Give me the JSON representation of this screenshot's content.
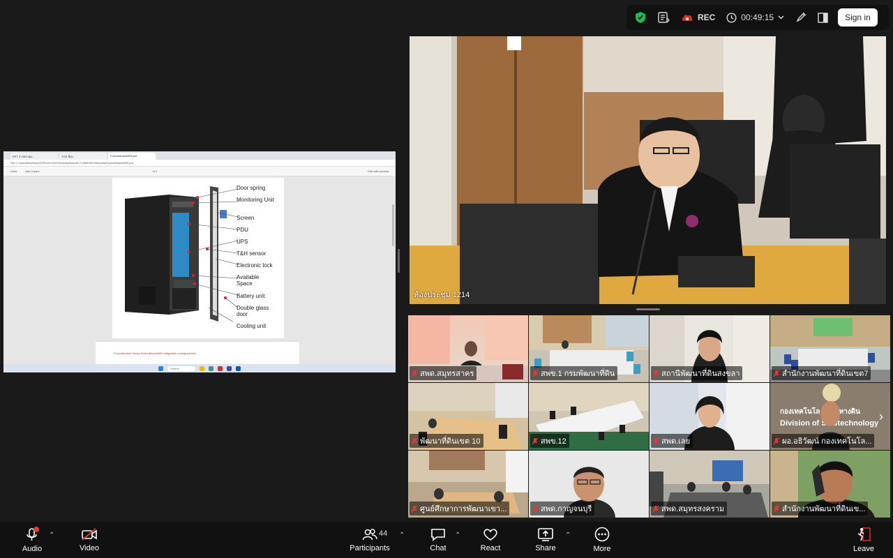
{
  "topbar": {
    "rec_label": "REC",
    "timer": "00:49:15",
    "signin_label": "Sign in"
  },
  "shared_screen": {
    "tabs": [
      "PPT การประชุม...",
      "TOR ห้อง...",
      "FusionModule500.pdf"
    ],
    "address": "File  C:/Users/Meeting%20Room%202/Desktop/Board/CT-2565/SDS/Modular/FusionModule500.pdf",
    "pdf_toolbar": [
      "Draw",
      "Ask Copilot",
      "of 2",
      "Edit with Acrobat"
    ],
    "legend": [
      "Door spring",
      "Monitoring Unit",
      "Screen",
      "PDU",
      "UPS",
      "T&H sensor",
      "Electronic lock",
      "Available Space",
      "Battery unit",
      "Double glass door",
      "Cooling unit"
    ],
    "caption": "FusionModule Series   FusionModule500 integrated cooling solution",
    "taskbar_search": "Search"
  },
  "main_video": {
    "label": "ห้องประชุม 1214"
  },
  "gallery": [
    {
      "name": "สพด.สมุทรสาคร"
    },
    {
      "name": "สพข.1 กรมพัฒนาที่ดิน"
    },
    {
      "name": "สถานีพัฒนาที่ดินสงขลา"
    },
    {
      "name": "สำนักงานพัฒนาที่ดินเขต7"
    },
    {
      "name": "พัฒนาที่ดินเขต 10"
    },
    {
      "name": "สพข.12"
    },
    {
      "name": "สพด.เลย"
    },
    {
      "name": "ผอ.อธิวัฒน์ กองเทคโนโล..."
    },
    {
      "name": "ศูนย์ศึกษาการพัฒนาเขา..."
    },
    {
      "name": "สพด.กาญจนบุรี"
    },
    {
      "name": "สพด.สมุทรสงคราม"
    },
    {
      "name": "สำนักงานพัฒนาที่ดินเข..."
    }
  ],
  "tile8_banner": {
    "line1": "กองเทคโนโล...ภาพทางดิน",
    "line2": "Division of S...otechnology"
  },
  "toolbar": {
    "audio_label": "Audio",
    "video_label": "Video",
    "participants_label": "Participants",
    "participants_count": "44",
    "chat_label": "Chat",
    "react_label": "React",
    "share_label": "Share",
    "more_label": "More",
    "leave_label": "Leave"
  },
  "colors": {
    "background": "#1a1a1a",
    "toolbar": "#111111",
    "rec_red": "#e02828",
    "mute_red": "#e53935",
    "shield_green": "#1db954",
    "leave_red": "#e02828"
  }
}
